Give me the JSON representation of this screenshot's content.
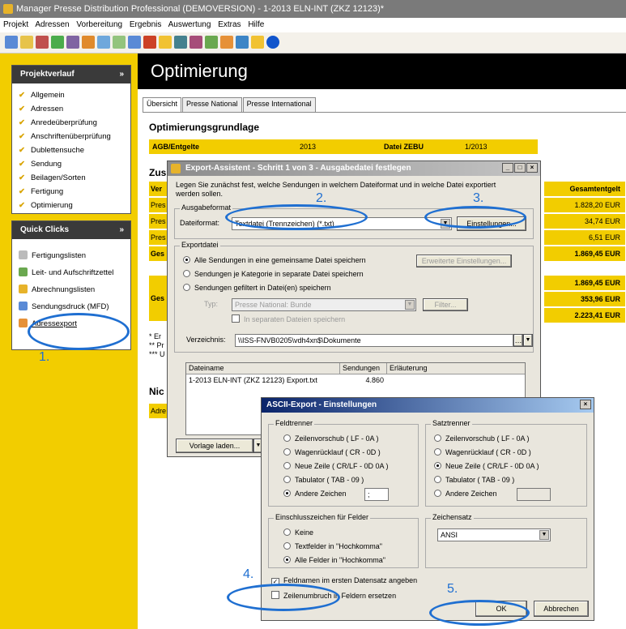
{
  "window": {
    "title": "Manager Presse Distribution Professional (DEMOVERSION) - 1-2013 ELN-INT (ZKZ 12123)*"
  },
  "menu": [
    "Projekt",
    "Adressen",
    "Vorbereitung",
    "Ergebnis",
    "Auswertung",
    "Extras",
    "Hilfe"
  ],
  "sidebar": {
    "projektverlauf": {
      "title": "Projektverlauf",
      "items": [
        "Allgemein",
        "Adressen",
        "Anredeüberprüfung",
        "Anschriftenüberprüfung",
        "Dublettensuche",
        "Sendung",
        "Beilagen/Sorten",
        "Fertigung",
        "Optimierung"
      ]
    },
    "quickclicks": {
      "title": "Quick Clicks",
      "items": [
        "Fertigungslisten",
        "Leit- und Aufschriftzettel",
        "Abrechnungslisten",
        "Sendungsdruck (MFD)",
        "Adressexport"
      ]
    }
  },
  "main": {
    "heading": "Optimierung",
    "tabs": [
      "Übersicht",
      "Presse National",
      "Presse International"
    ],
    "section_title": "Optimierungsgrundlage",
    "row1": {
      "label": "AGB/Entgelte",
      "value": "2013",
      "label2": "Datei ZEBU",
      "value2": "1/2013"
    },
    "section2": "Zus",
    "col_header": "Gesamtentgelt",
    "rows_left": [
      "Ver",
      "Pres",
      "Pres",
      "Pres",
      "Ges",
      "Ges"
    ],
    "amounts": [
      "1.828,20 EUR",
      "34,74 EUR",
      "6,51 EUR",
      "1.869,45 EUR",
      "1.869,45 EUR",
      "353,96 EUR",
      "2.223,41 EUR"
    ],
    "notes": [
      "* Er",
      "** Pr",
      "*** U"
    ],
    "section3": "Nic",
    "row3_left": "Adre"
  },
  "export_dialog": {
    "title": "Export-Assistent - Schritt 1 von 3 - Ausgabedatei festlegen",
    "intro": "Legen Sie zunächst fest, welche Sendungen in welchem Dateiformat und in welche Datei exportiert werden sollen.",
    "ausgabeformat_label": "Ausgabeformat",
    "dateiformat_label": "Dateiformat:",
    "dateiformat_value": "Textdatei (Trennzeichen) (*.txt)",
    "einstellungen_button": "Einstellungen...",
    "exportdatei_label": "Exportdatei",
    "radio1": "Alle Sendungen in eine gemeinsame Datei speichern",
    "radio2": "Sendungen je Kategorie in separate Datei speichern",
    "radio3": "Sendungen gefiltert in Datei(en) speichern",
    "erweiterte_button": "Erweiterte Einstellungen...",
    "typ_label": "Typ:",
    "typ_value": "Presse National: Bunde",
    "filter_button": "Filter...",
    "separate_check": "In separaten Dateien speichern",
    "verzeichnis_label": "Verzeichnis:",
    "verzeichnis_value": "\\\\ISS-FNVB0205\\vdh4xn$\\Dokumente",
    "table_headers": [
      "Dateiname",
      "Sendungen",
      "Erläuterung"
    ],
    "table_row": {
      "name": "1-2013 ELN-INT (ZKZ 12123) Export.txt",
      "count": "4.860",
      "note": ""
    },
    "vorlage_button": "Vorlage laden..."
  },
  "ascii_dialog": {
    "title": "ASCII-Export - Einstellungen",
    "feldtrenner_label": "Feldtrenner",
    "feld_options": [
      "Zeilenvorschub ( LF - 0A )",
      "Wagenrücklauf ( CR - 0D )",
      "Neue Zeile ( CR/LF - 0D 0A )",
      "Tabulator ( TAB - 09 )",
      "Andere Zeichen"
    ],
    "feld_other_value": ";",
    "satztrenner_label": "Satztrenner",
    "satz_options": [
      "Zeilenvorschub ( LF - 0A )",
      "Wagenrücklauf ( CR - 0D )",
      "Neue Zeile ( CR/LF - 0D 0A )",
      "Tabulator ( TAB - 09 )",
      "Andere Zeichen"
    ],
    "einschluss_label": "Einschlusszeichen für Felder",
    "einschluss_options": [
      "Keine",
      "Textfelder in \"Hochkomma\"",
      "Alle Felder in \"Hochkomma\""
    ],
    "zeichensatz_label": "Zeichensatz",
    "zeichensatz_value": "ANSI",
    "check1": "Feldnamen im ersten Datensatz angeben",
    "check2": "Zeilenumbruch in Feldern ersetzen",
    "ok_button": "OK",
    "cancel_button": "Abbrechen"
  },
  "annotations": [
    "1.",
    "2.",
    "3.",
    "4.",
    "5."
  ],
  "colors": {
    "accent_yellow": "#f2cd00",
    "annotation_blue": "#1f6fd1",
    "dialog_blue": "#0a246a"
  }
}
